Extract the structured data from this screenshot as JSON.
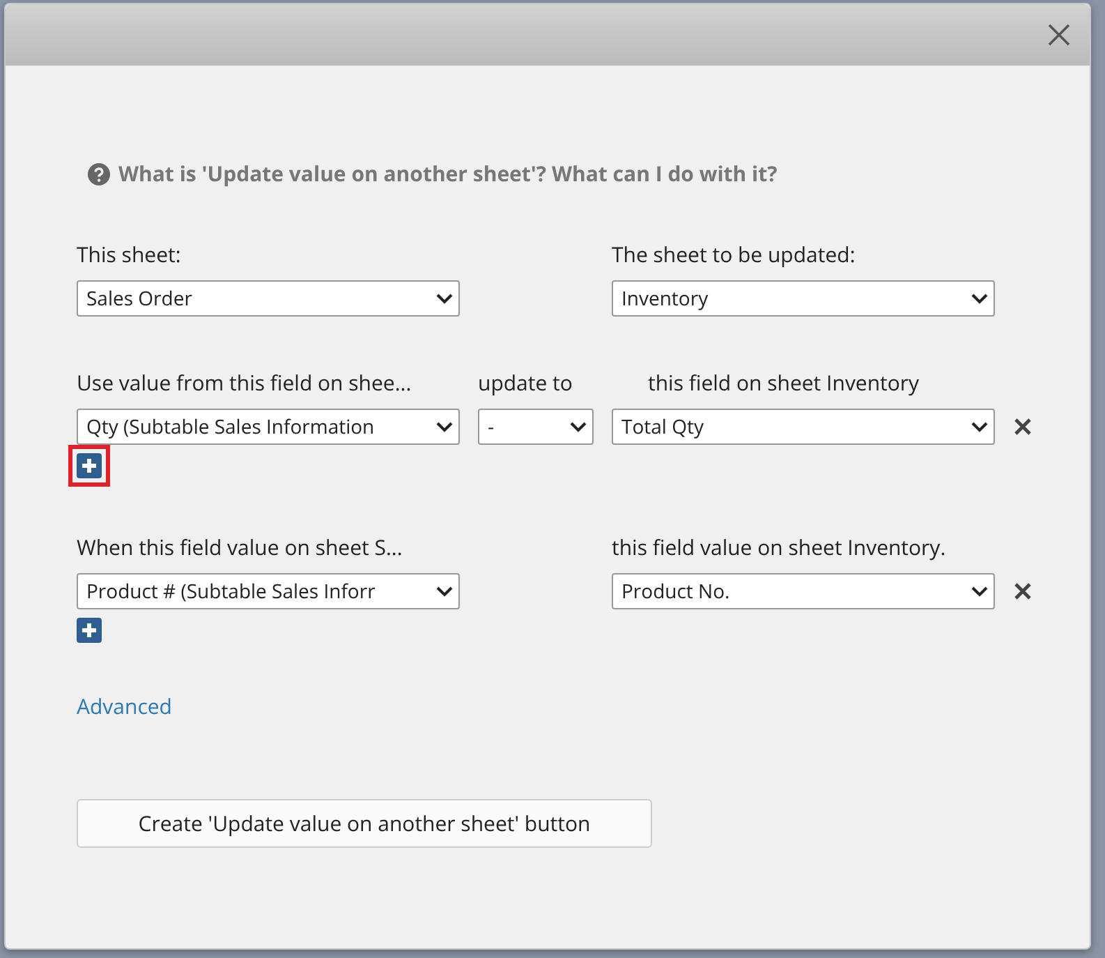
{
  "help_link": "What is 'Update value on another sheet'? What can I do with it?",
  "sheets": [
    {
      "label": "This sheet:",
      "value": "Sales Order"
    },
    {
      "label": "The sheet to be updated:",
      "value": "Inventory"
    }
  ],
  "update_section": {
    "source_label": "Use value from this field on shee...",
    "operator_label": "update to",
    "target_label": "this field on sheet Inventory",
    "rows": [
      {
        "source_field": "Qty (Subtable Sales Information",
        "operator": "-",
        "target_field": "Total Qty"
      }
    ],
    "add_button": {
      "highlighted": true
    }
  },
  "condition_section": {
    "source_label": "When this field value on sheet S...",
    "target_label": "this field value on sheet Inventory.",
    "rows": [
      {
        "source_field": "Product # (Subtable Sales Inforr",
        "target_field": "Product No."
      }
    ],
    "add_button": {
      "highlighted": false
    }
  },
  "advanced_link": "Advanced",
  "create_button": "Create 'Update value on another sheet' button"
}
